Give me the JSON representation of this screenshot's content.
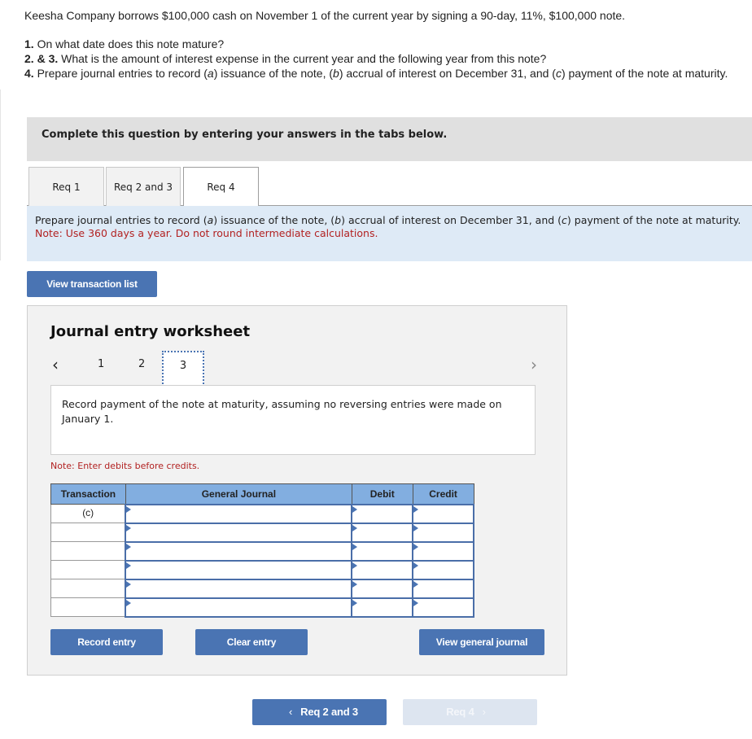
{
  "question": {
    "intro": "Keesha Company borrows $100,000 cash on November 1 of the current year by signing a 90-day, 11%, $100,000 note.",
    "items": [
      {
        "num": "1.",
        "text": " On what date does this note mature?"
      },
      {
        "num": "2. & 3.",
        "text": " What is the amount of interest expense in the current year and the following year from this note?"
      },
      {
        "num": "4.",
        "text_a": " Prepare journal entries to record (",
        "a": "a",
        "text_b": ") issuance of the note, (",
        "b": "b",
        "text_c": ") accrual of interest on December 31, and (",
        "c": "c",
        "text_d": ") payment of the note at maturity."
      }
    ]
  },
  "instruction_bar": "Complete this question by entering your answers in the tabs below.",
  "tabs": [
    {
      "label": "Req 1",
      "active": false
    },
    {
      "label": "Req 2 and 3",
      "active": false
    },
    {
      "label": "Req 4",
      "active": true
    }
  ],
  "req_panel": {
    "p1": "Prepare journal entries to record (",
    "a": "a",
    "p2": ") issuance of the note, (",
    "b": "b",
    "p3": ") accrual of interest on December 31, and (",
    "c": "c",
    "p4": ") payment of the note at maturity.",
    "note": "Note: Use 360 days a year. Do not round intermediate calculations."
  },
  "buttons": {
    "view_transaction_list": "View transaction list",
    "record_entry": "Record entry",
    "clear_entry": "Clear entry",
    "view_general_journal": "View general journal"
  },
  "worksheet": {
    "title": "Journal entry worksheet",
    "prev_icon": "‹",
    "next_icon": "›",
    "steps": [
      "1",
      "2",
      "3"
    ],
    "active_step": "3",
    "description": "Record payment of the note at maturity, assuming no reversing entries were made on January 1.",
    "note": "Note: Enter debits before credits.",
    "table": {
      "headers": [
        "Transaction",
        "General Journal",
        "Debit",
        "Credit"
      ],
      "rows": [
        {
          "transaction": "(c)",
          "general_journal": "",
          "debit": "",
          "credit": ""
        },
        {
          "transaction": "",
          "general_journal": "",
          "debit": "",
          "credit": ""
        },
        {
          "transaction": "",
          "general_journal": "",
          "debit": "",
          "credit": ""
        },
        {
          "transaction": "",
          "general_journal": "",
          "debit": "",
          "credit": ""
        },
        {
          "transaction": "",
          "general_journal": "",
          "debit": "",
          "credit": ""
        },
        {
          "transaction": "",
          "general_journal": "",
          "debit": "",
          "credit": ""
        }
      ]
    }
  },
  "bottom_nav": {
    "prev_label": "Req 2 and 3",
    "prev_icon": "‹",
    "next_label": "Req 4",
    "next_icon": "›"
  },
  "colors": {
    "accent": "#4a74b3",
    "header_blue": "#82aee0",
    "panel_blue": "#deeaf6",
    "note_red": "#b22222"
  }
}
